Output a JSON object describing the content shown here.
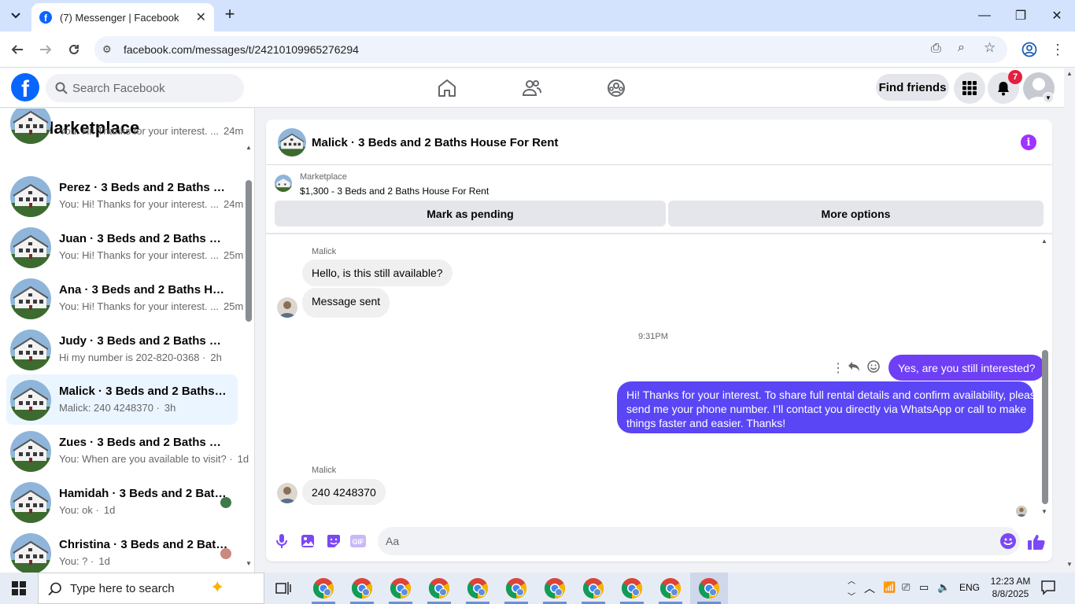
{
  "browser": {
    "tab_title": "(7) Messenger | Facebook",
    "url": "facebook.com/messages/t/24210109965276294"
  },
  "fb": {
    "search_placeholder": "Search Facebook",
    "find_friends": "Find friends",
    "notif_count": "7"
  },
  "sidebar": {
    "title": "Marketplace",
    "conversations": [
      {
        "name": "",
        "preview": "You: Hi! Thanks for your interest. ...",
        "time": "24m"
      },
      {
        "name": "Perez · 3 Beds and 2 Baths Hous...",
        "preview": "You: Hi! Thanks for your interest. ...",
        "time": "24m"
      },
      {
        "name": "Juan · 3 Beds and 2 Baths Hous...",
        "preview": "You: Hi! Thanks for your interest. ...",
        "time": "25m"
      },
      {
        "name": "Ana · 3 Beds and 2 Baths House ...",
        "preview": "You: Hi! Thanks for your interest. ...",
        "time": "25m"
      },
      {
        "name": "Judy · 3 Beds and 2 Baths Hous...",
        "preview": "Hi my number is 202-820-0368 ·",
        "time": "2h"
      },
      {
        "name": "Malick · 3 Beds and 2 Baths Hou...",
        "preview": "Malick: 240 4248370 ·",
        "time": "3h"
      },
      {
        "name": "Zues · 3 Beds and 2 Baths Hous...",
        "preview": "You: When are you available to visit? ·",
        "time": "1d"
      },
      {
        "name": "Hamidah · 3 Beds and 2 Baths...",
        "preview": "You: ok ·",
        "time": "1d"
      },
      {
        "name": "Christina · 3 Beds and 2 Baths...",
        "preview": "You: ? ·",
        "time": "1d"
      }
    ]
  },
  "chat": {
    "title": "Malick · 3 Beds and 2 Baths House For Rent",
    "marketplace_label": "Marketplace",
    "listing": "$1,300 - 3 Beds and 2 Baths House For Rent",
    "mark_pending": "Mark as pending",
    "more_options": "More options",
    "sender_name": "Malick",
    "msg1": "Hello, is this still available?",
    "msg2": "Message sent",
    "timestamp": "9:31PM",
    "out1": "Yes, are you still interested?",
    "out2_line1": "Hi! Thanks for your interest. To share full rental details and confirm availability, please",
    "out2_line2": "send me your phone number. I’ll contact you directly via WhatsApp or call to make",
    "out2_line3": "things faster and easier. Thanks!",
    "sender_name2": "Malick",
    "msg3": "240 4248370",
    "composer_placeholder": "Aa"
  },
  "taskbar": {
    "search_placeholder": "Type here to search",
    "language": "ENG",
    "time": "12:23 AM",
    "date": "8/8/2025"
  },
  "colors": {
    "fb_blue": "#0866ff",
    "messenger_purple": "#6a3cf5",
    "active_row": "#ebf5ff"
  }
}
